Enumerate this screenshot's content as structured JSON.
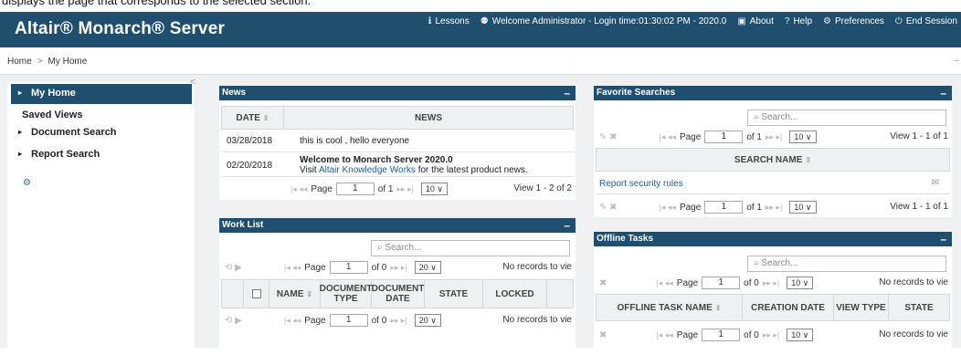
{
  "caption": "displays the page that corresponds to the selected section.",
  "header": {
    "brand": "Altair® Monarch® Server",
    "nav": [
      {
        "icon": "lessons-icon",
        "glyph": "ℹ",
        "label": "Lessons"
      },
      {
        "icon": "user-icon",
        "glyph": "⚉",
        "label": "Welcome Administrator - Login time:01:30:02 PM - 2020.0"
      },
      {
        "icon": "about-icon",
        "glyph": "▣",
        "label": "About"
      },
      {
        "icon": "help-icon",
        "glyph": "?",
        "label": "Help"
      },
      {
        "icon": "preferences-icon",
        "glyph": "⚙",
        "label": "Preferences"
      },
      {
        "icon": "power-icon",
        "glyph": "⏻",
        "label": "End Session"
      }
    ]
  },
  "breadcrumb": {
    "home": "Home",
    "sep": ">",
    "current": "My Home"
  },
  "sidebar": {
    "items": [
      {
        "label": "My Home",
        "arrow": "▸"
      },
      {
        "label": "Saved Views",
        "arrow": ""
      },
      {
        "label": "Document Search",
        "arrow": "▸"
      },
      {
        "label": "Report Search",
        "arrow": "▸"
      }
    ],
    "collapse": "<",
    "gear": "⚙"
  },
  "news": {
    "title": "News",
    "min": "–",
    "col_date": "DATE",
    "col_news": "NEWS",
    "rows": [
      {
        "date": "03/28/2018",
        "text": "this is cool , hello everyone"
      },
      {
        "date": "02/20/2018",
        "title": "Welcome to Monarch Server 2020.0",
        "pre": "Visit ",
        "link": "Altair Knowledge Works",
        "post": " for the latest product news."
      }
    ],
    "pager": {
      "page_label": "Page",
      "page": "1",
      "of": "of 1",
      "size": "10 ∨",
      "view": "View 1 - 2 of 2"
    }
  },
  "worklist": {
    "title": "Work List",
    "min": "–",
    "search": "⌕ Search...",
    "cols": [
      "NAME",
      "DOCUMENT TYPE",
      "DOCUMENT DATE",
      "STATE",
      "LOCKED"
    ],
    "pager": {
      "page_label": "Page",
      "page": "1",
      "of": "of 0",
      "size": "20 ∨",
      "view": "No records to vie"
    }
  },
  "favorites": {
    "title": "Favorite Searches",
    "min": "–",
    "search": "⌕ Search...",
    "col": "SEARCH NAME",
    "row": "Report security rules",
    "pager": {
      "page_label": "Page",
      "page": "1",
      "of": "of 1",
      "size": "10 ∨",
      "view": "View 1 - 1 of 1"
    }
  },
  "offline": {
    "title": "Offline Tasks",
    "min": "–",
    "search": "⌕ Search...",
    "cols": [
      "OFFLINE TASK NAME",
      "CREATION DATE",
      "VIEW TYPE",
      "STATE"
    ],
    "pager": {
      "page_label": "Page",
      "page": "1",
      "of": "of 0",
      "size": "10 ∨",
      "view": "No records to vie"
    }
  }
}
